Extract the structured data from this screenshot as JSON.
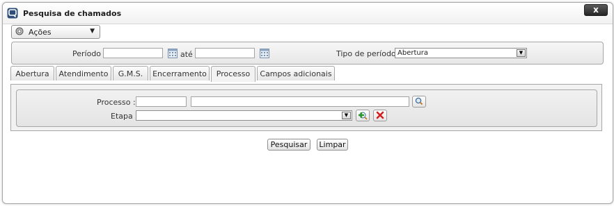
{
  "window": {
    "title": "Pesquisa de chamados",
    "close_label": "x"
  },
  "actions": {
    "label": "Ações"
  },
  "period": {
    "label": "Período :",
    "start_value": "",
    "separator": "até",
    "end_value": "",
    "type_label": "Tipo de período :",
    "type_value": "Abertura"
  },
  "tabs": [
    {
      "label": "Abertura"
    },
    {
      "label": "Atendimento"
    },
    {
      "label": "G.M.S."
    },
    {
      "label": "Encerramento"
    },
    {
      "label": "Processo"
    },
    {
      "label": "Campos adicionais"
    }
  ],
  "active_tab": "Processo",
  "processo": {
    "label": "Processo :",
    "code_value": "",
    "name_value": "",
    "etapa_label": "Etapa :",
    "etapa_value": ""
  },
  "buttons": {
    "search": "Pesquisar",
    "clear": "Limpar"
  }
}
